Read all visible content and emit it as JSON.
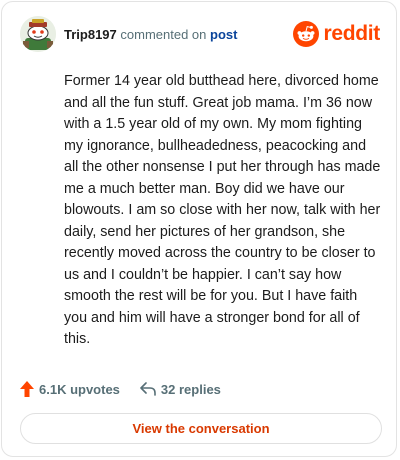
{
  "header": {
    "author": "Trip8197",
    "action_text": "commented on",
    "target_text": "post",
    "brand_name": "reddit",
    "avatar_icon": "snoo-avatar-icon"
  },
  "comment": {
    "body": "Former 14 year old butthead here, divorced home and all the fun stuff. Great job mama. I’m 36 now with a 1.5 year old of my own. My mom fighting my ignorance, bullheadedness, peacocking and all the other nonsense I put her through has made me a much better man. Boy did we have our blowouts. I am so close with her now, talk with her daily, send her pictures of her grandson, she recently moved across the country to be closer to us and I couldn’t be happier. I can’t say how smooth the rest will be for you. But I have faith you and him will have a stronger bond for all of this."
  },
  "stats": {
    "upvotes": "6.1K upvotes",
    "replies": "32 replies",
    "upvote_icon": "upvote-arrow-icon",
    "reply_icon": "reply-arrow-icon"
  },
  "actions": {
    "view_label": "View the conversation"
  },
  "colors": {
    "brand": "#ff4500",
    "link": "#0a449b",
    "muted": "#576f76",
    "button_text": "#d93900"
  }
}
